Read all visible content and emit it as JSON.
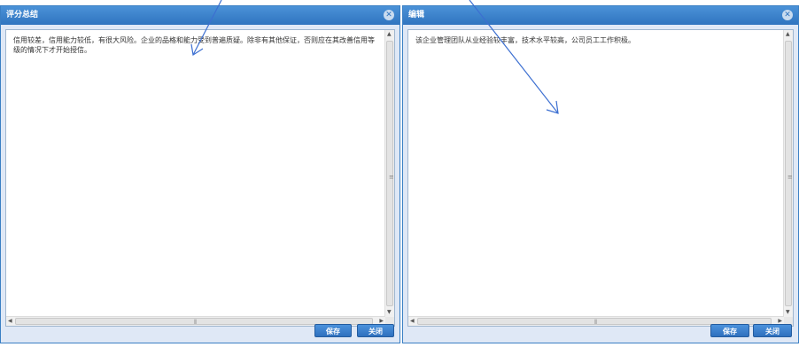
{
  "left_dialog": {
    "title": "评分总结",
    "text": "信用较差，信用能力较低，有很大风险。企业的品格和能力受到普遍质疑。除非有其他保证，否则应在其改善信用等级的情况下才开始授信。",
    "save_label": "保存",
    "close_label": "关闭"
  },
  "right_dialog": {
    "title": "编辑",
    "text": "该企业管理团队从业经验较丰富，技术水平较高，公司员工工作积极。",
    "save_label": "保存",
    "close_label": "关闭"
  },
  "colors": {
    "titlebar": "#2f74bf",
    "button": "#2e70be",
    "annotation": "#3c6fd1"
  },
  "icons": {
    "close": "close-icon",
    "scroll_up": "arrow-up-icon",
    "scroll_down": "arrow-down-icon",
    "scroll_left": "arrow-left-icon",
    "scroll_right": "arrow-right-icon"
  }
}
